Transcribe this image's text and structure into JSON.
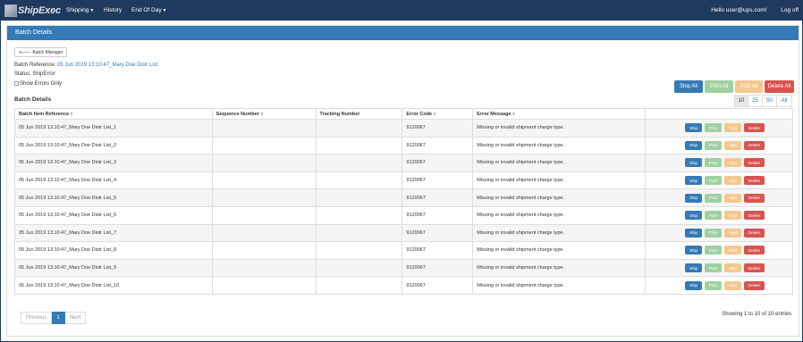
{
  "navbar": {
    "logo_text": "ShipExec",
    "menu": [
      {
        "label": "Shipping",
        "has_caret": true
      },
      {
        "label": "History",
        "has_caret": false
      },
      {
        "label": "End Of Day",
        "has_caret": true
      }
    ],
    "greeting": "Hello user@ups.com!",
    "logoff": "Log off"
  },
  "panel": {
    "title": "Batch Details"
  },
  "back_button": {
    "label": "Batch Manager",
    "icon": "arrow-left-icon"
  },
  "batch_reference": {
    "label": "Batch Reference:",
    "value": "05 Jun 2019 13:10:47_Mary Doe Distr List"
  },
  "status": {
    "label": "Status:",
    "value": "ShipError"
  },
  "show_errors_only": "Show Errors Only",
  "section_label": "Batch Details",
  "actions": {
    "ship_all": "Ship All",
    "print_all": "Print All",
    "void_all": "Void All",
    "delete_all": "Delete All"
  },
  "page_sizes": [
    "10",
    "25",
    "50",
    "All"
  ],
  "table": {
    "headers": [
      "Batch Item Reference",
      "Sequence Number",
      "Tracking Number",
      "Error Code",
      "Error Message",
      ""
    ],
    "rows": [
      {
        "ref": "05 Jun 2019 13:10:47_Mary Doe Distr List_1",
        "seq": "",
        "tracking": "",
        "code": "9120067",
        "message": "Missing or invalid shipment charge type."
      },
      {
        "ref": "05 Jun 2019 13:10:47_Mary Doe Distr List_2",
        "seq": "",
        "tracking": "",
        "code": "9120067",
        "message": "Missing or invalid shipment charge type."
      },
      {
        "ref": "05 Jun 2019 13:10:47_Mary Doe Distr List_3",
        "seq": "",
        "tracking": "",
        "code": "9120067",
        "message": "Missing or invalid shipment charge type."
      },
      {
        "ref": "05 Jun 2019 13:10:47_Mary Doe Distr List_4",
        "seq": "",
        "tracking": "",
        "code": "9120067",
        "message": "Missing or invalid shipment charge type."
      },
      {
        "ref": "05 Jun 2019 13:10:47_Mary Doe Distr List_5",
        "seq": "",
        "tracking": "",
        "code": "9120067",
        "message": "Missing or invalid shipment charge type."
      },
      {
        "ref": "05 Jun 2019 13:10:47_Mary Doe Distr List_6",
        "seq": "",
        "tracking": "",
        "code": "9120067",
        "message": "Missing or invalid shipment charge type."
      },
      {
        "ref": "05 Jun 2019 13:10:47_Mary Doe Distr List_7",
        "seq": "",
        "tracking": "",
        "code": "9120067",
        "message": "Missing or invalid shipment charge type."
      },
      {
        "ref": "05 Jun 2019 13:10:47_Mary Doe Distr List_8",
        "seq": "",
        "tracking": "",
        "code": "9120067",
        "message": "Missing or invalid shipment charge type."
      },
      {
        "ref": "05 Jun 2019 13:10:47_Mary Doe Distr List_9",
        "seq": "",
        "tracking": "",
        "code": "9120067",
        "message": "Missing or invalid shipment charge type."
      },
      {
        "ref": "05 Jun 2019 13:10:47_Mary Doe Distr List_10",
        "seq": "",
        "tracking": "",
        "code": "9120067",
        "message": "Missing or invalid shipment charge type."
      }
    ],
    "row_actions": {
      "ship": "Ship",
      "print": "Print",
      "void": "Void",
      "delete": "Delete"
    }
  },
  "pagination": {
    "previous": "Previous",
    "current": "1",
    "next": "Next"
  },
  "entries_info": "Showing 1 to 10 of 10 entries",
  "colors": {
    "navbar": "#1f3a5f",
    "primary": "#337ab7",
    "success": "#9fd19f",
    "warning": "#f4c88d",
    "danger": "#d9534f"
  }
}
